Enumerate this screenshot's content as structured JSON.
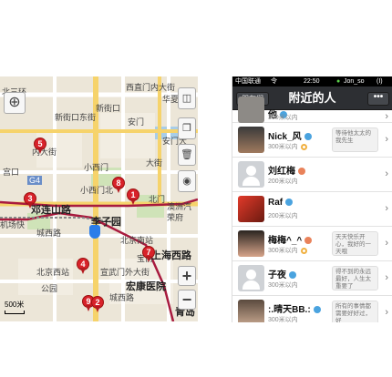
{
  "map": {
    "street_labels": [
      "西直门内大街",
      "新街口东街",
      "北三环",
      "新街口",
      "华夏",
      "安门",
      "安门大",
      "内大街",
      "小西门",
      "大街",
      "宫口",
      "G4",
      "小西门北",
      "北门",
      "澳洲汽",
      "荣府",
      "机场快",
      "城西路",
      "宣武门外大街",
      "城西路",
      "宝前",
      "公园",
      "北京南站",
      "北京西站"
    ],
    "big_labels": [
      "邓连山路",
      "李子园",
      "上海西路",
      "宏康医院",
      "青岛"
    ],
    "pins": [
      "5",
      "3",
      "8",
      "1",
      "7",
      "4",
      "9",
      "2"
    ],
    "scale_label": "500米",
    "buttons": {
      "locate_icon": "crosshair-icon",
      "traffic_icon": "layers-icon",
      "trash_icon": "trash-icon",
      "photo_icon": "camera-icon",
      "zoom_in": "+",
      "zoom_out": "−"
    },
    "colors": {
      "pin": "#d8222a",
      "route": "#a81a3e",
      "water": "#a8cde8",
      "road": "#ffffff",
      "highway": "#f6d36b"
    }
  },
  "phone": {
    "status": {
      "carrier": "中国联通",
      "wifi": "令",
      "time": "22:50",
      "user": "Jon_so",
      "battery": "(I)"
    },
    "nav": {
      "back_label": "朋友们",
      "title": "附近的人",
      "more_label": "•••"
    },
    "users": [
      {
        "name": "他",
        "distance": "300米以内",
        "gender": "m",
        "avatar": "photo",
        "signature": "",
        "partial": true
      },
      {
        "name": "Nick_风",
        "distance": "300米以内",
        "gender": "m",
        "avatar": "photo",
        "signature": "等待他太太的我先生",
        "badge": true
      },
      {
        "name": "刘红梅",
        "distance": "200米以内",
        "gender": "f",
        "avatar": "default",
        "signature": ""
      },
      {
        "name": "Raf",
        "distance": "200米以内",
        "gender": "m",
        "avatar": "photo",
        "signature": ""
      },
      {
        "name": "梅梅^_^",
        "distance": "300米以内",
        "gender": "f",
        "avatar": "photo",
        "signature": "天天快乐开心，我好的一天哦",
        "badge": true
      },
      {
        "name": "子夜",
        "distance": "300米以内",
        "gender": "m",
        "avatar": "default",
        "signature": "得不到的永远最好，人生太重要了"
      },
      {
        "name": ":.晴天BB.:",
        "distance": "300米以内",
        "gender": "m",
        "avatar": "photo",
        "signature": "所有的事情都需要好好过，好"
      }
    ]
  }
}
